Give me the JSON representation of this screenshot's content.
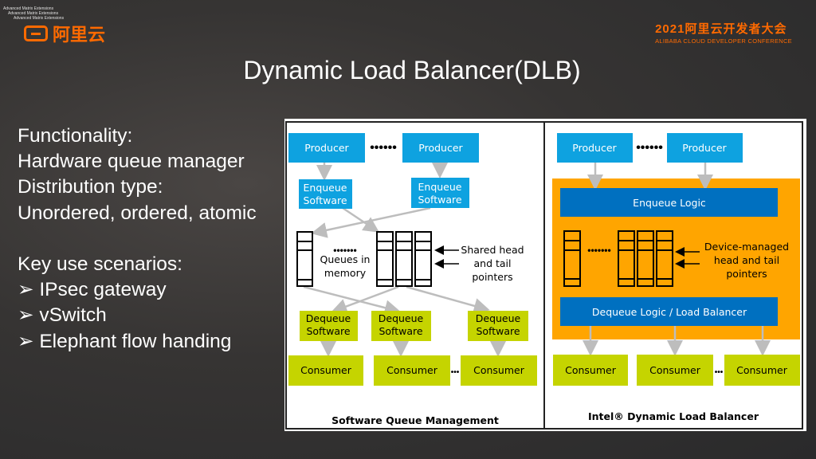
{
  "header": {
    "tiny_lines": [
      "Advanced Matrix Extensions",
      "Advanced Matrix Extensions",
      "Advanced Matrix Extensions"
    ],
    "logo_text": "阿里云",
    "conference_title": "2021阿里云开发者大会",
    "conference_subtitle": "ALIBABA CLOUD DEVELOPER CONFERENCE"
  },
  "slide": {
    "title": "Dynamic Load Balancer(DLB)",
    "bullets": [
      "Functionality:",
      "Hardware queue manager",
      "Distribution type:",
      "Unordered, ordered, atomic",
      "",
      "Key use scenarios:",
      "➢ IPsec gateway",
      "➢ vSwitch",
      "➢ Elephant flow handing"
    ]
  },
  "diagram": {
    "colors": {
      "producer": "#0ea2e0",
      "software": "#c5d400",
      "consumer": "#c5d400",
      "dlb_bg": "#ffa500",
      "logic": "#0070c0",
      "arrow": "#bdbdbd"
    },
    "left": {
      "producer": "Producer",
      "enqueue_line1": "Enqueue",
      "enqueue_line2": "Software",
      "queues_line1": "Queues in",
      "queues_line2": "memory",
      "pointers_line1": "Shared head",
      "pointers_line2": "and tail",
      "pointers_line3": "pointers",
      "dequeue_line1": "Dequeue",
      "dequeue_line2": "Software",
      "consumer": "Consumer",
      "caption": "Software Queue Management"
    },
    "right": {
      "producer": "Producer",
      "enqueue_logic": "Enqueue Logic",
      "pointers_line1": "Device-managed",
      "pointers_line2": "head and tail",
      "pointers_line3": "pointers",
      "dequeue_logic": "Dequeue Logic / Load Balancer",
      "consumer": "Consumer",
      "caption": "Intel® Dynamic Load Balancer"
    }
  }
}
